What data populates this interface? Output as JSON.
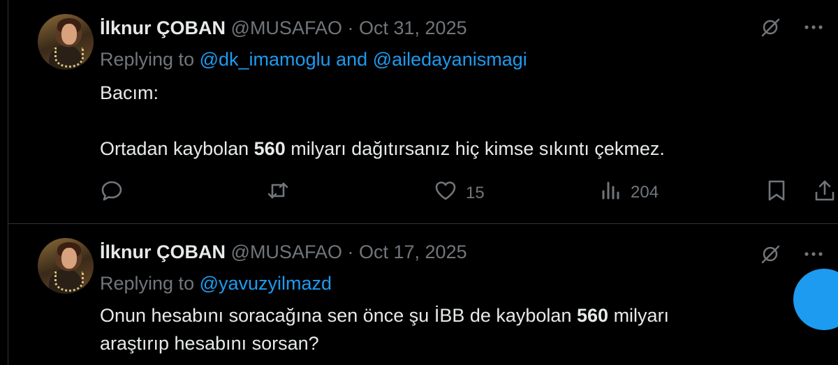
{
  "tweets": [
    {
      "author_name": "İlknur ÇOBAN",
      "handle": "@MUSAFAO",
      "separator": "·",
      "date": "Oct 31, 2025",
      "replying_prefix": "Replying to",
      "replying_to_1": "@dk_imamoglu",
      "replying_and": "and",
      "replying_to_2": "@ailedayanismagi",
      "text_line1": "Bacım:",
      "text_line2_pre": "Ortadan kaybolan",
      "text_line2_bold": "560",
      "text_line2_post": "milyarı dağıtırsanız hiç kimse sıkıntı çekmez.",
      "likes": "15",
      "views": "204"
    },
    {
      "author_name": "İlknur ÇOBAN",
      "handle": "@MUSAFAO",
      "separator": "·",
      "date": "Oct 17, 2025",
      "replying_prefix": "Replying to",
      "replying_to_1": "@yavuzyilmazd",
      "text_line1_pre": "Onun hesabını soracağına sen önce şu İBB de kaybolan",
      "text_line1_bold": "560",
      "text_line1_post": "milyarı",
      "text_line2": "araştırıp hesabını sorsan?"
    }
  ],
  "icons": {
    "grok": "grok-icon",
    "more": "more-icon",
    "reply": "reply-icon",
    "retweet": "retweet-icon",
    "like": "like-icon",
    "views": "views-icon",
    "bookmark": "bookmark-icon",
    "share": "share-icon"
  },
  "colors": {
    "link": "#1d9bf0",
    "muted": "#71767b",
    "text": "#e7e9ea",
    "background": "#000000"
  }
}
